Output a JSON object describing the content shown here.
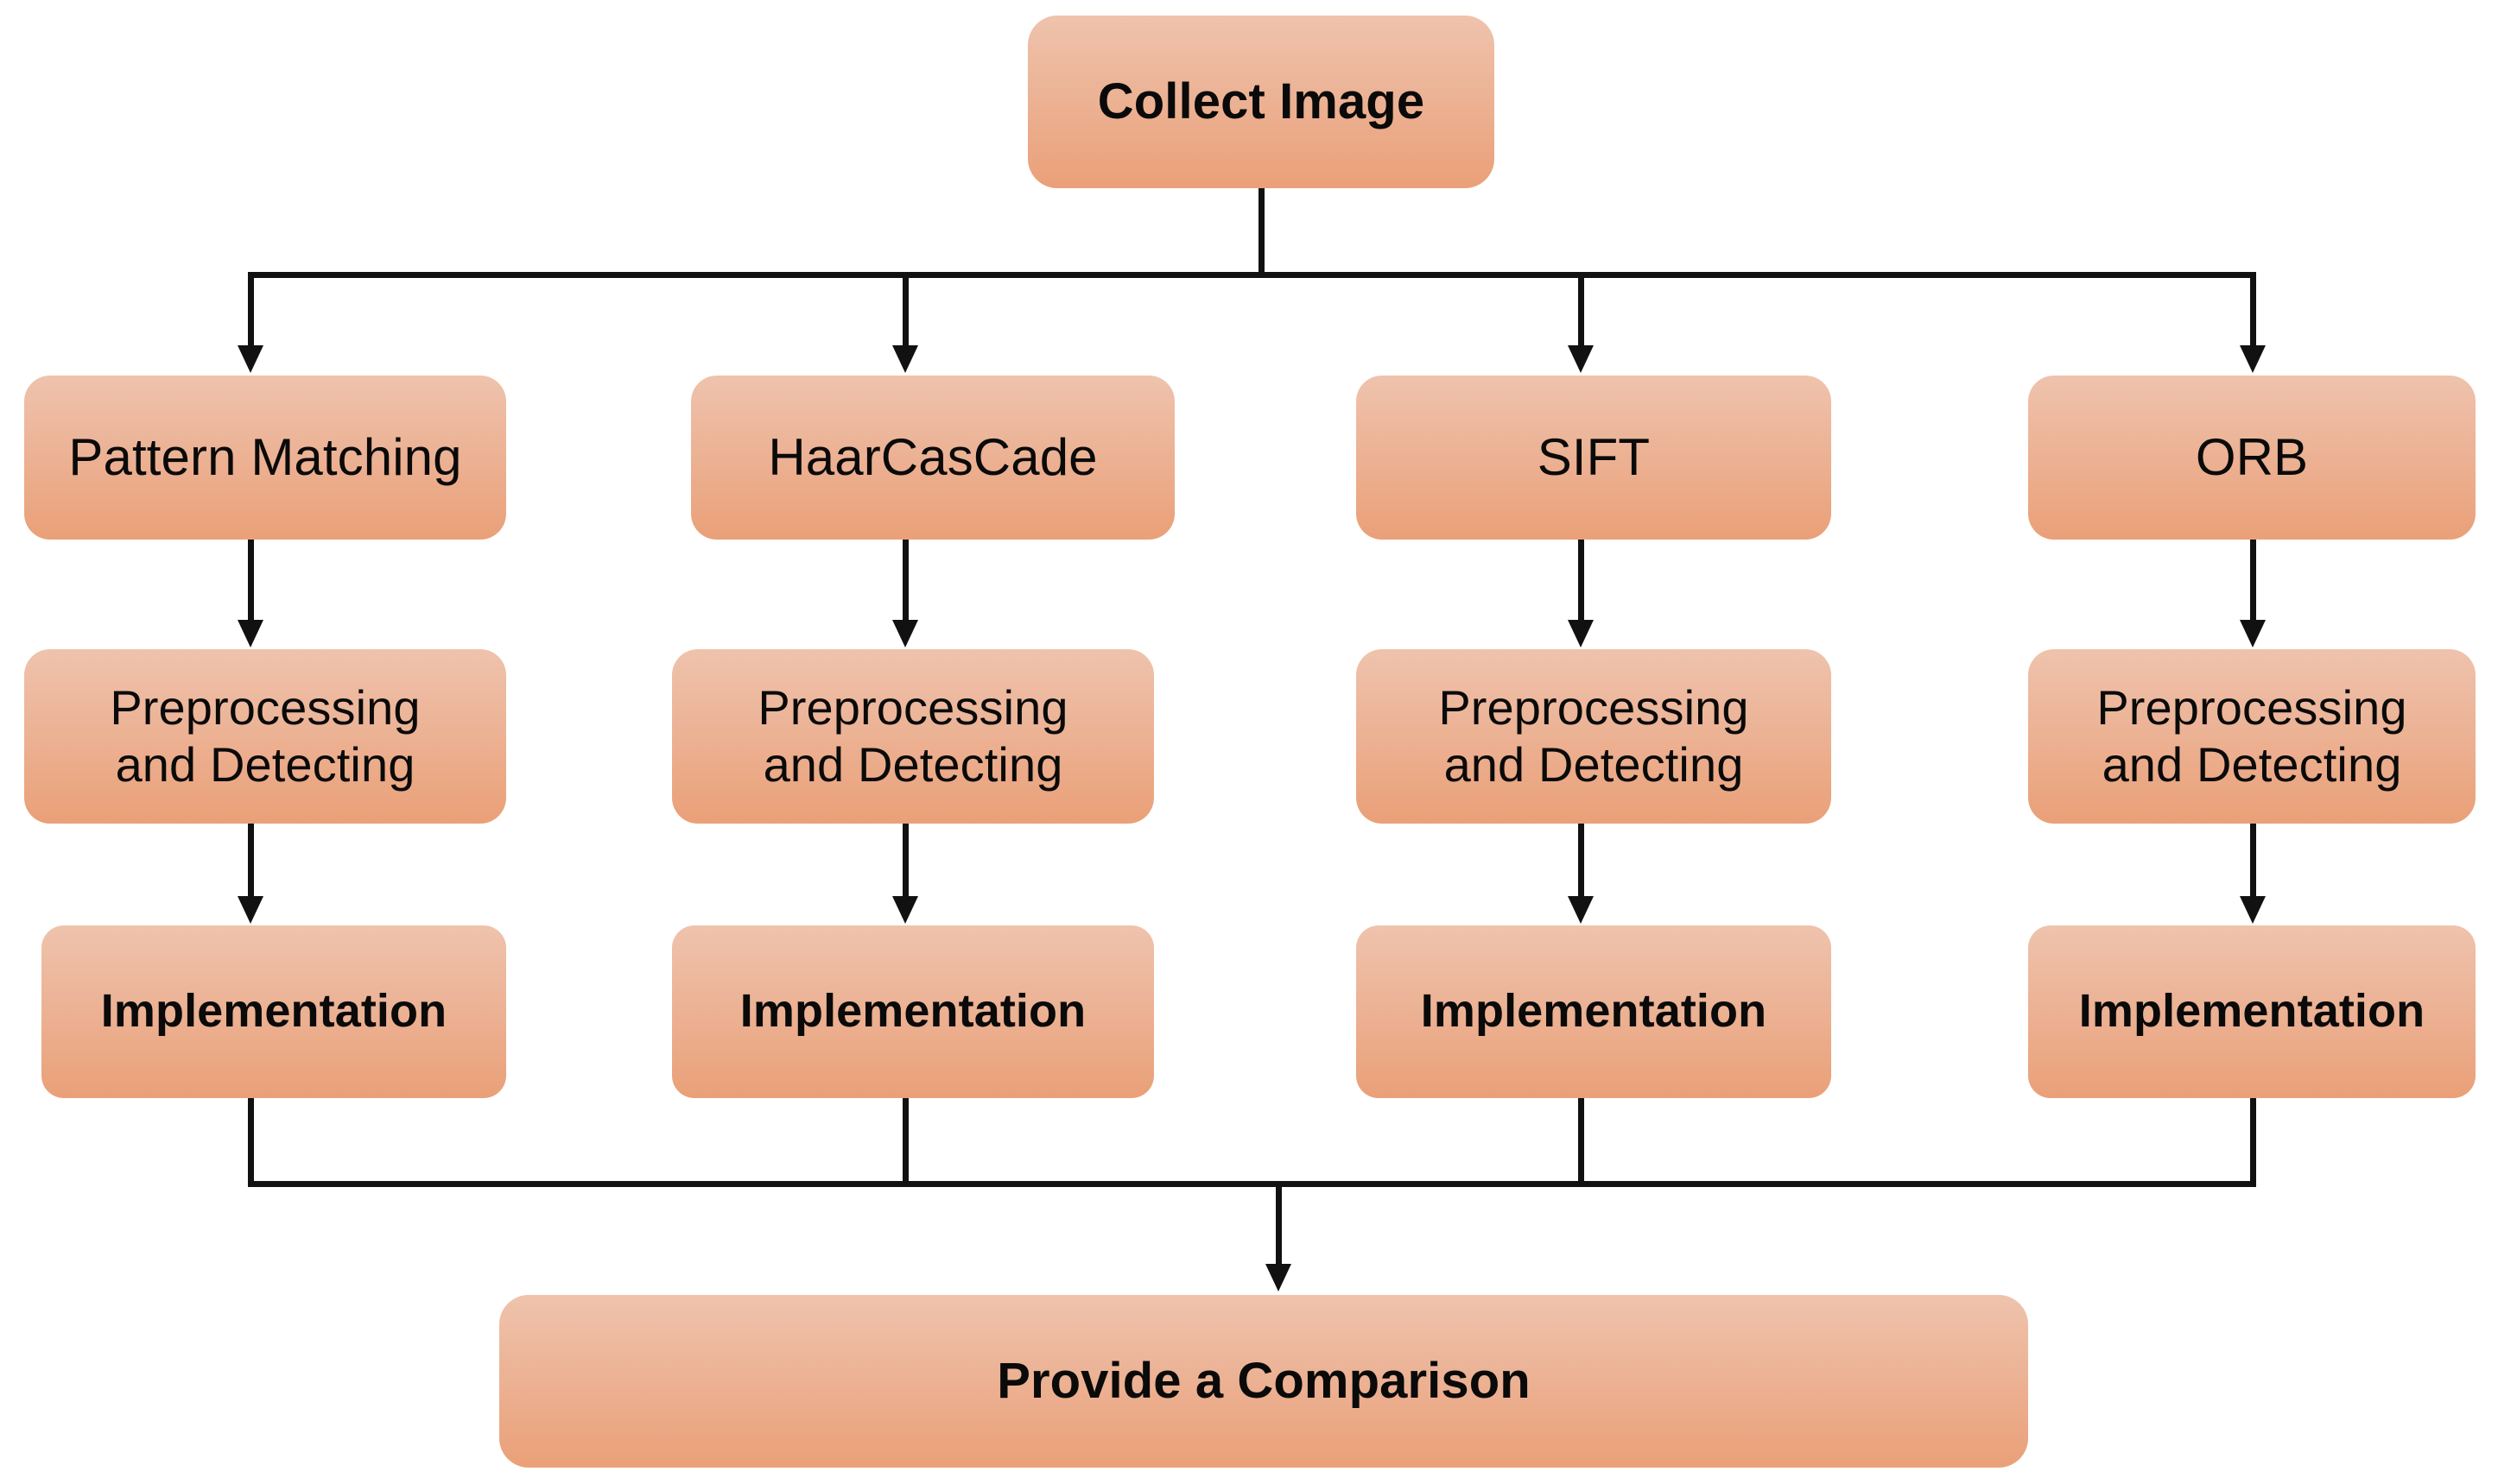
{
  "diagram": {
    "title_node": {
      "label": "Collect Image"
    },
    "methods": [
      {
        "label": "Pattern Matching"
      },
      {
        "label": "HaarCasCade"
      },
      {
        "label": "SIFT"
      },
      {
        "label": "ORB"
      }
    ],
    "stage_preprocessing": [
      {
        "label": "Preprocessing\nand Detecting"
      },
      {
        "label": "Preprocessing\nand Detecting"
      },
      {
        "label": "Preprocessing\nand Detecting"
      },
      {
        "label": "Preprocessing\nand Detecting"
      }
    ],
    "stage_implementation": [
      {
        "label": "Implementation"
      },
      {
        "label": "Implementation"
      },
      {
        "label": "Implementation"
      },
      {
        "label": "Implementation"
      }
    ],
    "result_node": {
      "label": "Provide a Comparison"
    },
    "colors": {
      "node_fill_top": "#efc3ad",
      "node_fill_mid": "#ecb396",
      "node_fill_bottom": "#eaa078",
      "connector": "#111111",
      "text": "#0a0a0a",
      "background": "#ffffff"
    }
  }
}
